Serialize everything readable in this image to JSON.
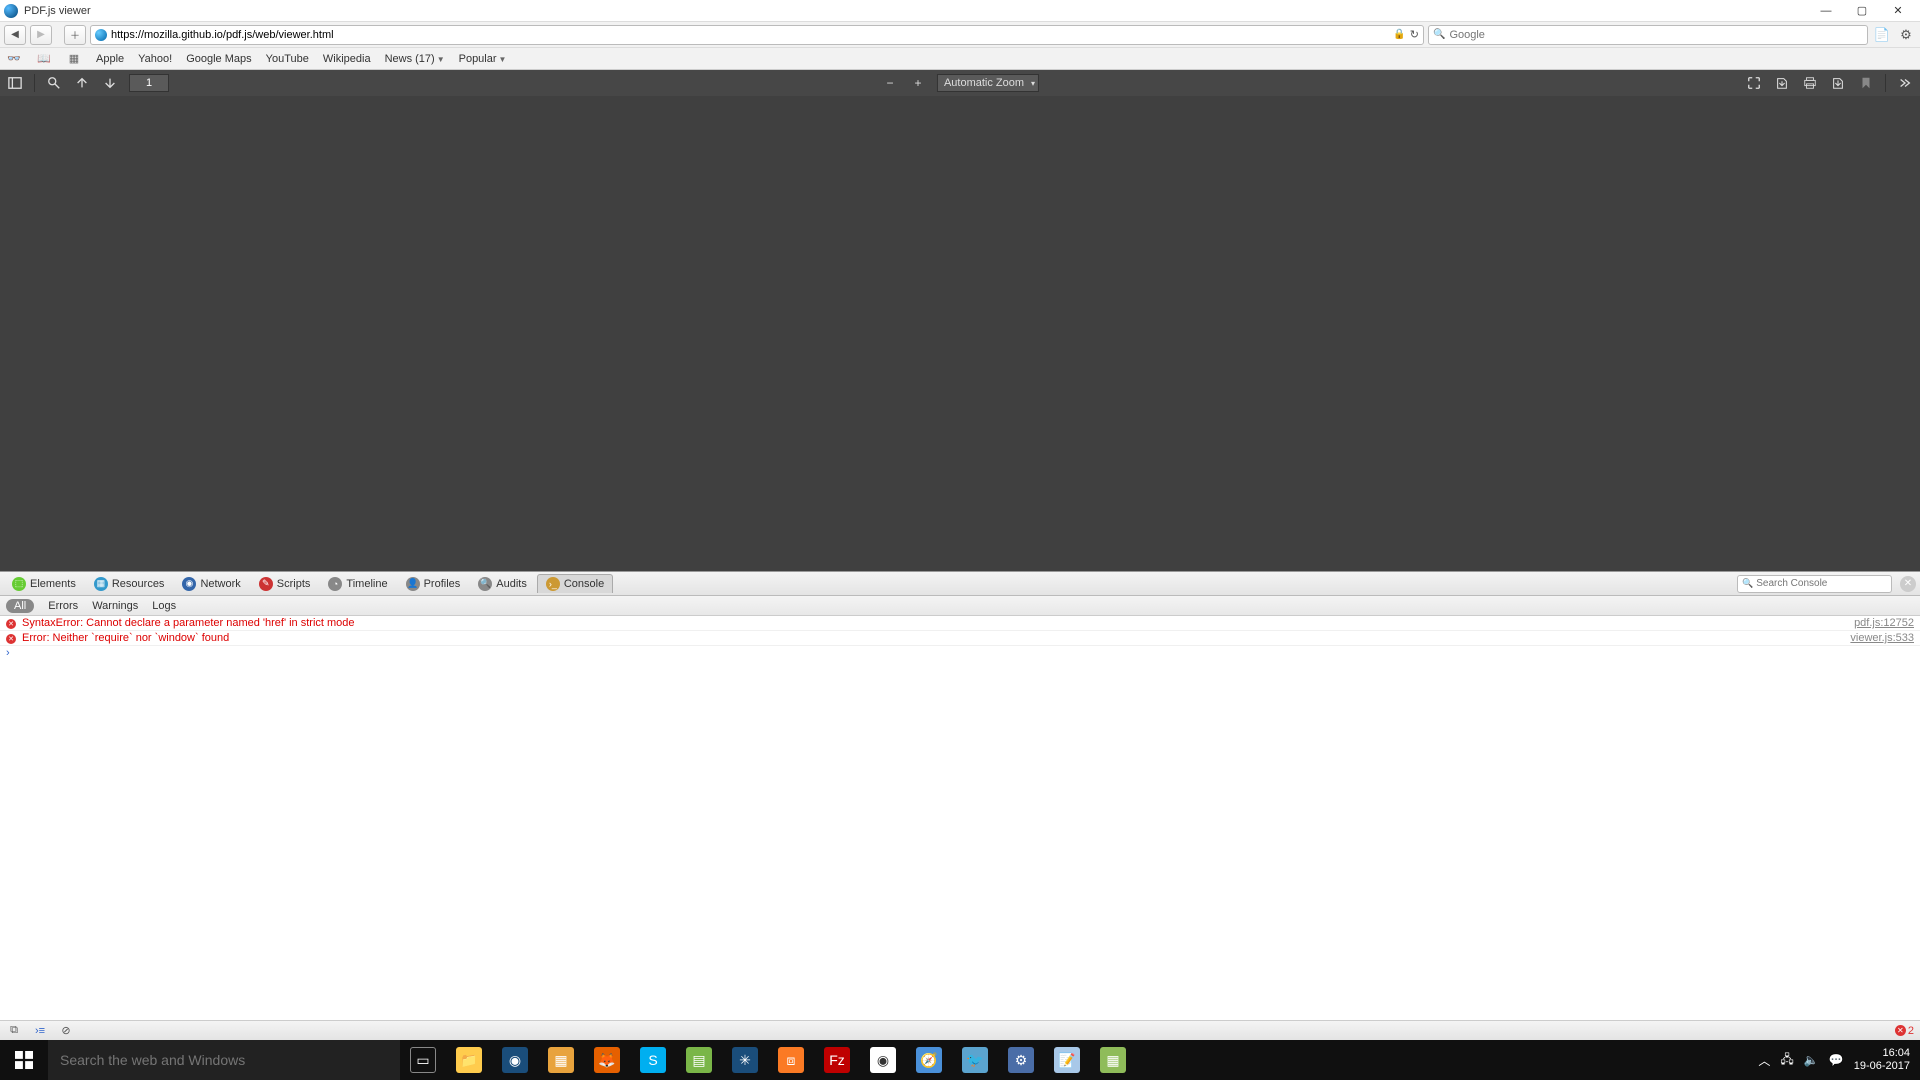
{
  "window": {
    "title": "PDF.js viewer"
  },
  "addressbar": {
    "url": "https://mozilla.github.io/pdf.js/web/viewer.html"
  },
  "searchbar": {
    "placeholder": "Google"
  },
  "bookmarks": [
    "Apple",
    "Yahoo!",
    "Google Maps",
    "YouTube",
    "Wikipedia",
    "News (17)",
    "Popular"
  ],
  "pdf": {
    "page": "1",
    "zoom_label": "Automatic Zoom"
  },
  "devtools": {
    "tabs": [
      "Elements",
      "Resources",
      "Network",
      "Scripts",
      "Timeline",
      "Profiles",
      "Audits",
      "Console"
    ],
    "active_tab": "Console",
    "search_placeholder": "Search Console",
    "filters": [
      "All",
      "Errors",
      "Warnings",
      "Logs"
    ],
    "active_filter": "All",
    "console": [
      {
        "msg": "SyntaxError: Cannot declare a parameter named 'href'  in strict mode",
        "src": "pdf.js:12752"
      },
      {
        "msg": "Error: Neither `require` nor `window` found",
        "src": "viewer.js:533"
      }
    ],
    "error_count": "2"
  },
  "taskbar": {
    "search_placeholder": "Search the web and Windows",
    "clock_time": "16:04",
    "clock_date": "19-06-2017"
  }
}
